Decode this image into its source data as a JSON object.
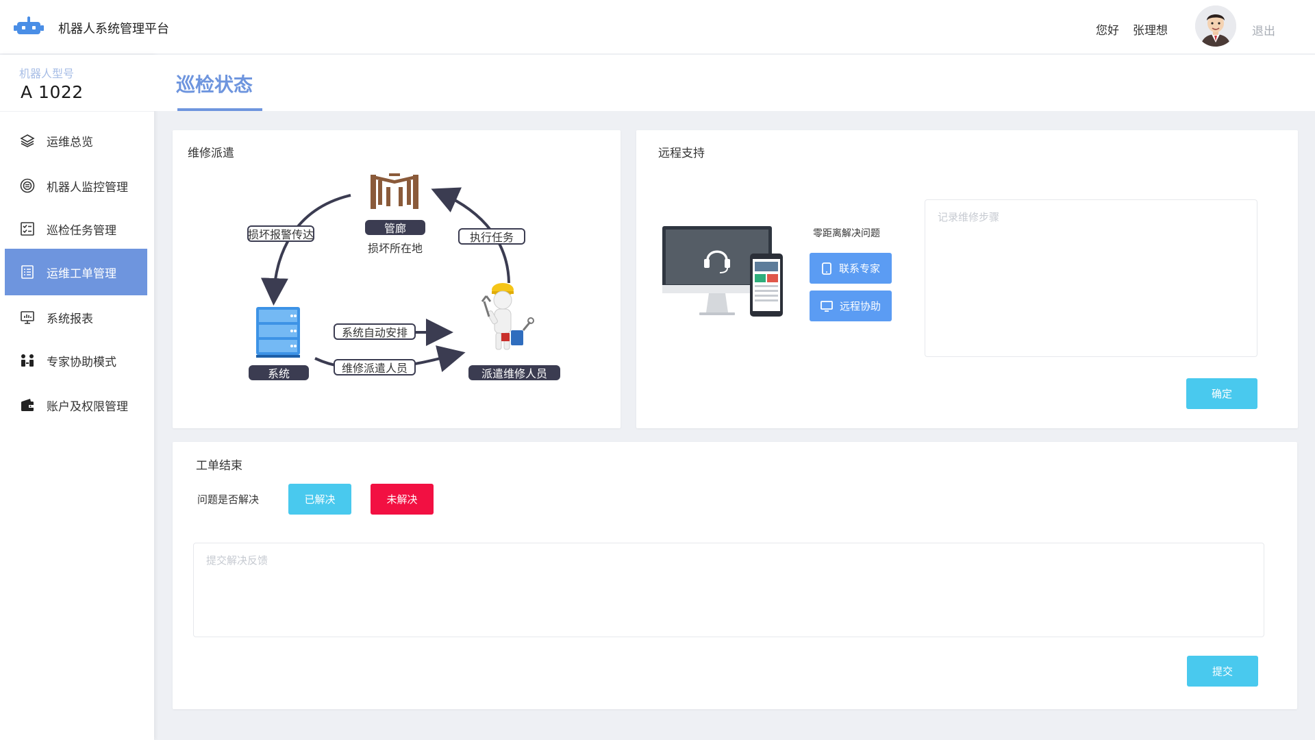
{
  "header": {
    "app_title": "机器人系统管理平台",
    "greeting": "您好",
    "username": "张理想",
    "logout": "退出",
    "logo_icon": "robot-icon"
  },
  "sidebar": {
    "model_label": "机器人型号",
    "model_value": "A 1022",
    "items": [
      {
        "label": "运维总览",
        "icon": "layers-icon"
      },
      {
        "label": "机器人监控管理",
        "icon": "monitor-circle-icon"
      },
      {
        "label": "巡检任务管理",
        "icon": "checklist-icon"
      },
      {
        "label": "运维工单管理",
        "icon": "document-list-icon",
        "active": true
      },
      {
        "label": "系统报表",
        "icon": "screen-report-icon"
      },
      {
        "label": "专家协助模式",
        "icon": "people-icon"
      },
      {
        "label": "账户及权限管理",
        "icon": "wallet-icon"
      }
    ]
  },
  "page": {
    "title": "巡检状态"
  },
  "dispatch": {
    "title": "维修派遣",
    "report_pill": "损坏报警传达",
    "location_tag": "管廊",
    "location_caption": "损坏所在地",
    "execute_pill": "执行任务",
    "system_tag": "系统",
    "auto_pill": "系统自动安排",
    "dispatch_pill": "维修派遣人员",
    "worker_tag": "派遣维修人员"
  },
  "remote": {
    "title": "远程支持",
    "caption": "零距离解决问题",
    "contact_button": "联系专家",
    "assist_button": "远程协助",
    "notes_placeholder": "记录维修步骤",
    "confirm_button": "确定"
  },
  "closure": {
    "title": "工单结束",
    "question": "问题是否解决",
    "resolved_button": "已解决",
    "unresolved_button": "未解决",
    "feedback_placeholder": "提交解决反馈",
    "submit_button": "提交"
  },
  "colors": {
    "accent": "#6e95de",
    "button_blue": "#5b9cf3",
    "button_cyan": "#49c9ee",
    "button_red": "#f21042",
    "diagram_dark": "#3b3c51"
  }
}
